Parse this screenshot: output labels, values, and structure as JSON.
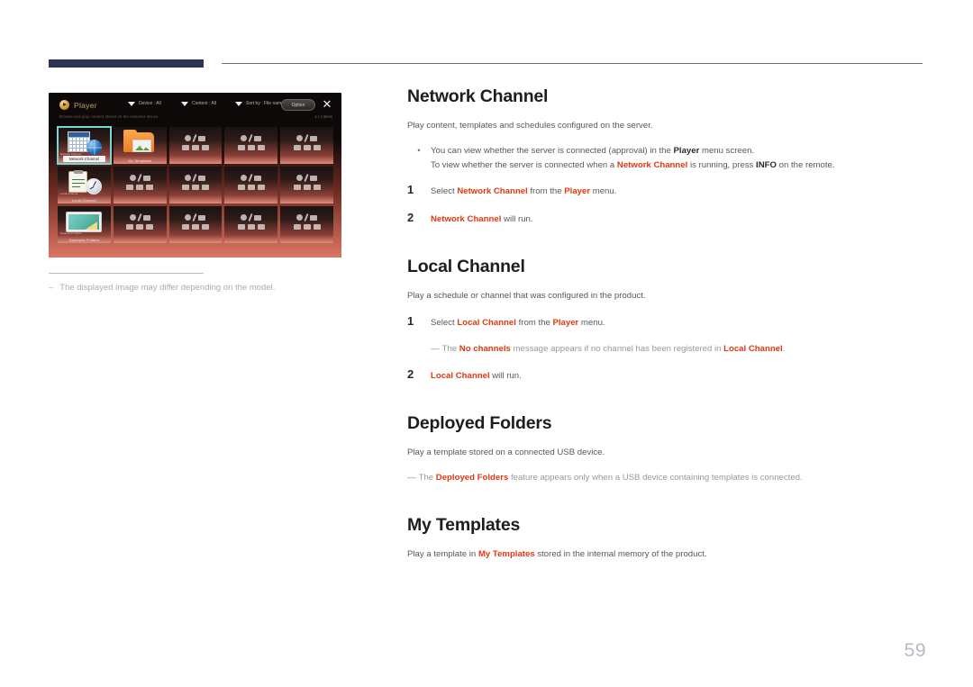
{
  "page": {
    "number": "59"
  },
  "figure": {
    "caption_dash": "–",
    "caption": "The displayed image may differ depending on the model.",
    "player": {
      "title": "Player",
      "subtitle": "Browse and play content stored on the selected device.",
      "counter": "1 / 4 items",
      "menus": [
        {
          "label": "Device : All"
        },
        {
          "label": "Content : All"
        },
        {
          "label": "Sort by : File name"
        }
      ],
      "option_label": "Option",
      "close_label": "✕",
      "tiles": [
        {
          "label": "Network Channel",
          "sub": "Network Channel",
          "icon": "network-channel-icon",
          "selected": true
        },
        {
          "label": "My Templates",
          "sub": "",
          "icon": "folder-templates-icon",
          "selected": false
        },
        {
          "label": "",
          "sub": "",
          "icon": "media-placeholder-icon",
          "selected": false
        },
        {
          "label": "",
          "sub": "",
          "icon": "media-placeholder-icon",
          "selected": false
        },
        {
          "label": "",
          "sub": "",
          "icon": "media-placeholder-icon",
          "selected": false
        },
        {
          "label": "Local Channel",
          "sub": "Local Channel",
          "icon": "local-channel-icon",
          "selected": false
        },
        {
          "label": "",
          "sub": "",
          "icon": "media-placeholder-icon",
          "selected": false
        },
        {
          "label": "",
          "sub": "",
          "icon": "media-placeholder-icon",
          "selected": false
        },
        {
          "label": "",
          "sub": "",
          "icon": "media-placeholder-icon",
          "selected": false
        },
        {
          "label": "",
          "sub": "",
          "icon": "media-placeholder-icon",
          "selected": false
        },
        {
          "label": "Deployed Folders",
          "sub": "Deployed Folders",
          "icon": "deployed-folders-icon",
          "selected": false
        },
        {
          "label": "",
          "sub": "",
          "icon": "media-placeholder-icon",
          "selected": false
        },
        {
          "label": "",
          "sub": "",
          "icon": "media-placeholder-icon",
          "selected": false
        },
        {
          "label": "",
          "sub": "",
          "icon": "media-placeholder-icon",
          "selected": false
        },
        {
          "label": "",
          "sub": "",
          "icon": "media-placeholder-icon",
          "selected": false
        }
      ]
    }
  },
  "sections": {
    "network_channel": {
      "heading": "Network Channel",
      "lead": "Play content, templates and schedules configured on the server.",
      "bullet": {
        "marker": "•",
        "line1_a": "You can view whether the server is connected (approval) in the ",
        "line1_b": "Player",
        "line1_c": " menu screen.",
        "line2_a": "To view whether the server is connected when a ",
        "line2_b": "Network Channel",
        "line2_c": " is running, press ",
        "line2_d": "INFO",
        "line2_e": " on the remote."
      },
      "step1": {
        "num": "1",
        "a": "Select ",
        "b": "Network Channel",
        "c": " from the ",
        "d": "Player",
        "e": " menu."
      },
      "step2": {
        "num": "2",
        "a": "Network Channel",
        "b": " will run."
      }
    },
    "local_channel": {
      "heading": "Local Channel",
      "lead": "Play a schedule or channel that was configured in the product.",
      "step1": {
        "num": "1",
        "a": "Select ",
        "b": "Local Channel",
        "c": " from the ",
        "d": "Player",
        "e": " menu."
      },
      "note": {
        "dash": "―",
        "a": "The ",
        "b": "No channels",
        "c": " message appears if no channel has been registered in ",
        "d": "Local Channel",
        "e": "."
      },
      "step2": {
        "num": "2",
        "a": "Local Channel",
        "b": " will run."
      }
    },
    "deployed_folders": {
      "heading": "Deployed Folders",
      "lead": "Play a template stored on a connected USB device.",
      "note": {
        "dash": "―",
        "a": "The ",
        "b": "Deployed Folders",
        "c": " feature appears only when a USB device containing templates is connected."
      }
    },
    "my_templates": {
      "heading": "My Templates",
      "lead_a": "Play a template in ",
      "lead_b": "My Templates",
      "lead_c": " stored in the internal memory of the product."
    }
  },
  "colors": {
    "accent_red": "#e4380f",
    "rule_navy": "#2b3253",
    "page_number": "#b6bac6"
  }
}
